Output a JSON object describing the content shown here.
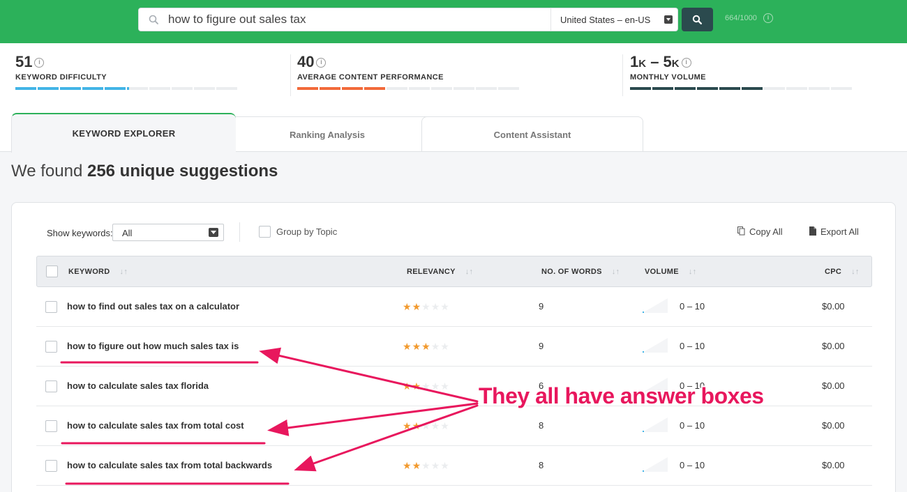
{
  "search": {
    "query": "how to figure out sales tax",
    "locale": "United States – en-US",
    "quota": "664/1000"
  },
  "metrics": [
    {
      "value": "51",
      "label": "KEYWORD DIFFICULTY",
      "level": 0.51,
      "color": "#42b4e6"
    },
    {
      "value": "40",
      "label": "AVERAGE CONTENT PERFORMANCE",
      "level": 0.4,
      "color": "#f26a3a"
    },
    {
      "value_main": "1",
      "value_unit1": "K",
      "value_mid": " – 5",
      "value_unit2": "K",
      "label": "MONTHLY VOLUME",
      "level": 0.6,
      "color": "#2b4a4e"
    }
  ],
  "tabs": [
    {
      "label": "KEYWORD EXPLORER",
      "active": true
    },
    {
      "label": "Ranking Analysis",
      "active": false
    },
    {
      "label": "Content Assistant",
      "active": false
    }
  ],
  "results": {
    "prefix": "We found ",
    "count_text": "256 unique suggestions"
  },
  "controls": {
    "show_label": "Show keywords:",
    "show_value": "All",
    "group_label": "Group by Topic",
    "copy_label": "Copy All",
    "export_label": "Export All"
  },
  "table": {
    "headers": {
      "keyword": "KEYWORD",
      "relevancy": "RELEVANCY",
      "words": "NO. OF WORDS",
      "volume": "VOLUME",
      "cpc": "CPC"
    },
    "rows": [
      {
        "keyword": "how to find out sales tax on a calculator",
        "stars": 2,
        "words": "9",
        "volume": "0 – 10",
        "cpc": "$0.00"
      },
      {
        "keyword": "how to figure out how much sales tax is",
        "stars": 3,
        "words": "9",
        "volume": "0 – 10",
        "cpc": "$0.00"
      },
      {
        "keyword": "how to calculate sales tax florida",
        "stars": 2,
        "words": "6",
        "volume": "0 – 10",
        "cpc": "$0.00"
      },
      {
        "keyword": "how to calculate sales tax from total cost",
        "stars": 2,
        "words": "8",
        "volume": "0 – 10",
        "cpc": "$0.00"
      },
      {
        "keyword": "how to calculate sales tax from total backwards",
        "stars": 2,
        "words": "8",
        "volume": "0 – 10",
        "cpc": "$0.00"
      }
    ]
  },
  "annotation": {
    "text": "They all have answer boxes",
    "color": "#e8175d"
  }
}
